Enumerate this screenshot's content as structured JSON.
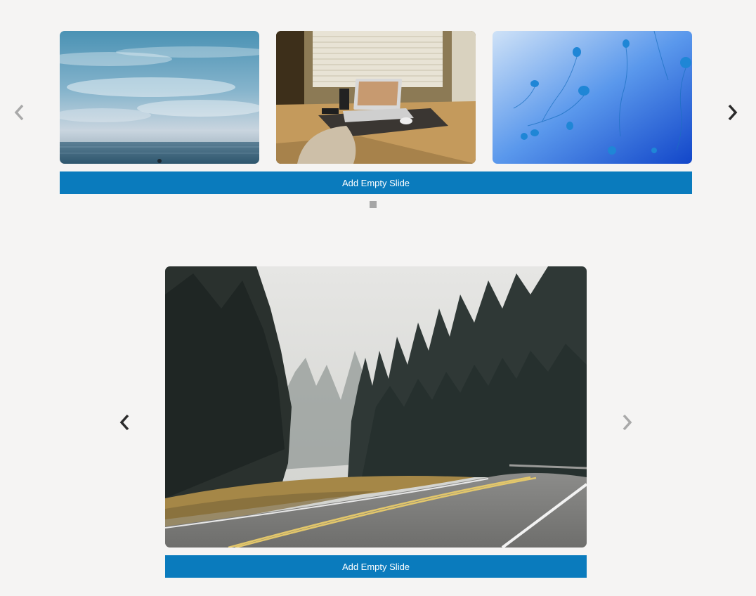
{
  "colors": {
    "background": "#f5f4f3",
    "button": "#0a7bbd",
    "button_text": "#ffffff",
    "arrow_active": "#2b2b2b",
    "arrow_disabled": "#a9a9a9",
    "dot": "#a6a6a6"
  },
  "carousel_top": {
    "slides": [
      {
        "image": "ocean-sky-photo"
      },
      {
        "image": "laptop-desk-window-photo"
      },
      {
        "image": "blue-jellyfish-photo"
      }
    ],
    "prev_icon": "chevron-left-icon",
    "next_icon": "chevron-right-icon",
    "prev_disabled": true,
    "next_disabled": false,
    "add_button_label": "Add Empty Slide",
    "page_count": 1
  },
  "carousel_bottom": {
    "slides": [
      {
        "image": "forest-road-photo"
      }
    ],
    "prev_icon": "chevron-left-icon",
    "next_icon": "chevron-right-icon",
    "prev_disabled": false,
    "next_disabled": true,
    "add_button_label": "Add Empty Slide"
  }
}
